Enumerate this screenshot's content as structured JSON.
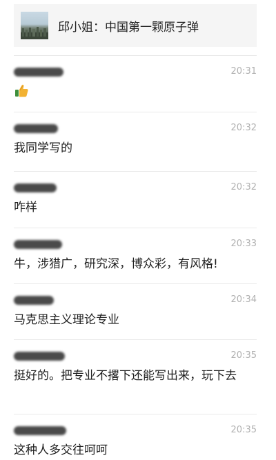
{
  "article": {
    "title": "邱小姐：中国第一颗原子弹",
    "thumbnail_icon": "article-thumbnail"
  },
  "comments": [
    {
      "time": "20:31",
      "text": "",
      "emoji": "thumbs-up-icon"
    },
    {
      "time": "20:32",
      "text": "我同学写的"
    },
    {
      "time": "20:32",
      "text": "咋样"
    },
    {
      "time": "20:33",
      "text": "牛，涉猎广，研究深，博众彩，有风格!"
    },
    {
      "time": "20:34",
      "text": "马克思主义理论专业"
    },
    {
      "time": "20:35",
      "text": "挺好的。把专业不撂下还能写出来，玩下去"
    },
    {
      "time": "20:35",
      "text": "这种人多交往呵呵"
    }
  ],
  "colors": {
    "card_bg": "#f5f5f5",
    "divider": "#e9e9e9",
    "time": "#b0b0b0",
    "text": "#1e1e1e"
  }
}
